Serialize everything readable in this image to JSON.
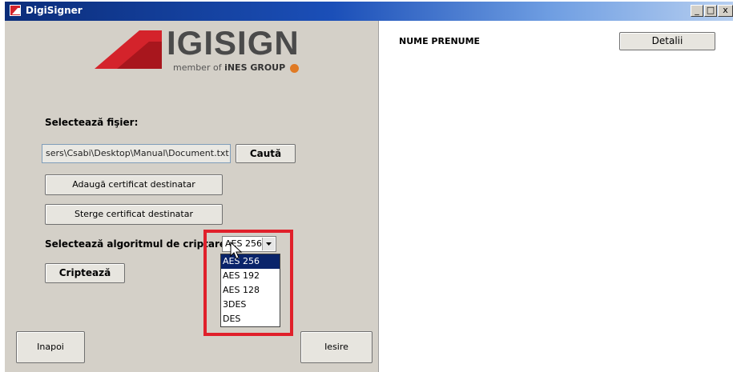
{
  "window": {
    "title": "DigiSigner",
    "minimize_label": "_",
    "maximize_label": "□",
    "close_label": "x"
  },
  "logo": {
    "text": "IGISIGN",
    "tagline_prefix": "member of ",
    "tagline_brand": "iNES GROUP"
  },
  "form": {
    "select_file_label": "Selectează fişier:",
    "file_path_value": "sers\\Csabi\\Desktop\\Manual\\Document.txt",
    "browse_button": "Caută",
    "add_cert_button": "Adaugă certificat destinatar",
    "remove_cert_button": "Sterge certificat destinatar",
    "algorithm_label": "Selectează algoritmul de criptare:",
    "algorithm_selected": "AES 256",
    "algorithm_options": [
      "AES 256",
      "AES 192",
      "AES 128",
      "3DES",
      "DES"
    ],
    "encrypt_button": "Criptează"
  },
  "footer": {
    "back_button": "Inapoi",
    "exit_button": "Iesire"
  },
  "recipients": {
    "column_header": "NUME PRENUME",
    "details_button": "Detalii"
  },
  "colors": {
    "accent_red": "#e0202b",
    "selection_blue": "#0a246a",
    "panel_gray": "#d4d0c8"
  }
}
